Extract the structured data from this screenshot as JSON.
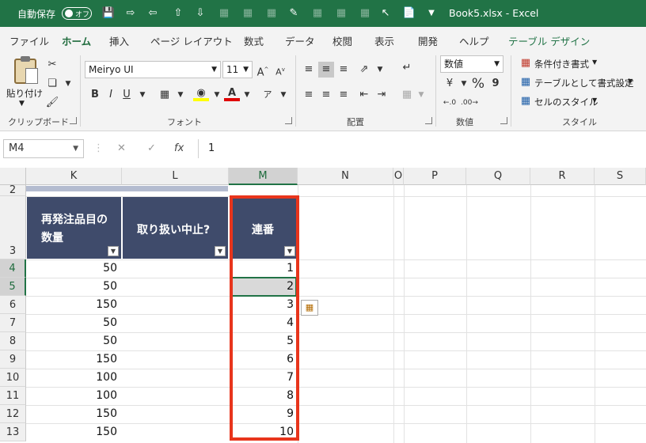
{
  "titlebar": {
    "autosave_label": "自動保存",
    "autosave_state": "オフ",
    "document_title": "Book5.xlsx  -  Excel"
  },
  "tabs": [
    "ファイル",
    "ホーム",
    "挿入",
    "ページ レイアウト",
    "数式",
    "データ",
    "校閲",
    "表示",
    "開発",
    "ヘルプ",
    "テーブル デザイン"
  ],
  "active_tab": "ホーム",
  "ribbon": {
    "clipboard": {
      "paste_label": "貼り付け",
      "group_label": "クリップボード"
    },
    "font": {
      "font_name": "Meiryo UI",
      "font_size": "11",
      "bold": "B",
      "italic": "I",
      "underline": "U",
      "group_label": "フォント"
    },
    "alignment": {
      "group_label": "配置"
    },
    "number": {
      "format": "数値",
      "currency": "¥",
      "percent": "%",
      "comma": "9",
      "group_label": "数値"
    },
    "styles": {
      "conditional_formatting": "条件付き書式",
      "format_as_table": "テーブルとして書式設定",
      "cell_styles": "セルのスタイル",
      "group_label": "スタイル"
    }
  },
  "formula_bar": {
    "name_box": "M4",
    "cancel": "✕",
    "enter": "✓",
    "fx": "fx",
    "value": "1"
  },
  "columns": [
    "K",
    "L",
    "M",
    "N",
    "O",
    "P",
    "Q",
    "R",
    "S"
  ],
  "selected_column": "M",
  "rows": [
    "2",
    "3",
    "4",
    "5",
    "6",
    "7",
    "8",
    "9",
    "10",
    "11",
    "12",
    "13"
  ],
  "selected_rows": [
    "4",
    "5"
  ],
  "table": {
    "headers": [
      "再発注品目の数量",
      "取り扱い中止?",
      "連番"
    ],
    "header_lines": [
      [
        "再発注品目の",
        "数量"
      ],
      [
        "取り扱い中止?"
      ],
      [
        "連番"
      ]
    ],
    "quantities": [
      "50",
      "50",
      "150",
      "50",
      "50",
      "150",
      "100",
      "100",
      "150",
      "150"
    ],
    "discontinued": [
      "",
      "",
      "",
      "",
      "",
      "",
      "",
      "",
      "",
      ""
    ],
    "serials": [
      "1",
      "2",
      "3",
      "4",
      "5",
      "6",
      "7",
      "8",
      "9",
      "10"
    ]
  },
  "colors": {
    "excel_green": "#217346",
    "table_header": "#3f4b6b",
    "highlight_border": "#e8351c"
  }
}
